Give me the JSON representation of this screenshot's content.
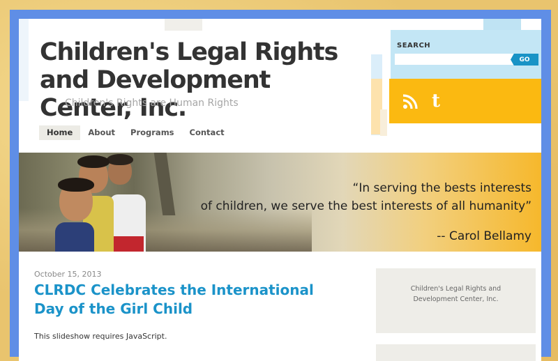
{
  "site": {
    "title": "Children's Legal Rights and Development Center, Inc.",
    "tagline": "Children's Rights are Human Rights"
  },
  "nav": {
    "items": [
      {
        "label": "Home",
        "active": true
      },
      {
        "label": "About",
        "active": false
      },
      {
        "label": "Programs",
        "active": false
      },
      {
        "label": "Contact",
        "active": false
      }
    ]
  },
  "search": {
    "label": "SEARCH",
    "placeholder": "",
    "button": "GO"
  },
  "social": {
    "icons": [
      "rss-icon",
      "twitter-icon"
    ],
    "twitter_glyph": "t"
  },
  "banner": {
    "quote_line1": "“In serving the bests interests",
    "quote_line2": "of children, we serve the best interests of all humanity”",
    "author": "-- Carol Bellamy"
  },
  "post": {
    "date": "October 15, 2013",
    "title": "CLRDC Celebrates the International Day of the Girl Child",
    "body": "This slideshow requires JavaScript."
  },
  "sidebar": {
    "widget_text": "Children's Legal Rights and Development Center, Inc."
  },
  "colors": {
    "frame": "#5f8ee6",
    "accent_blue": "#1b93c9",
    "search_bg": "#c3e6f5",
    "social_bg": "#fbb911"
  }
}
